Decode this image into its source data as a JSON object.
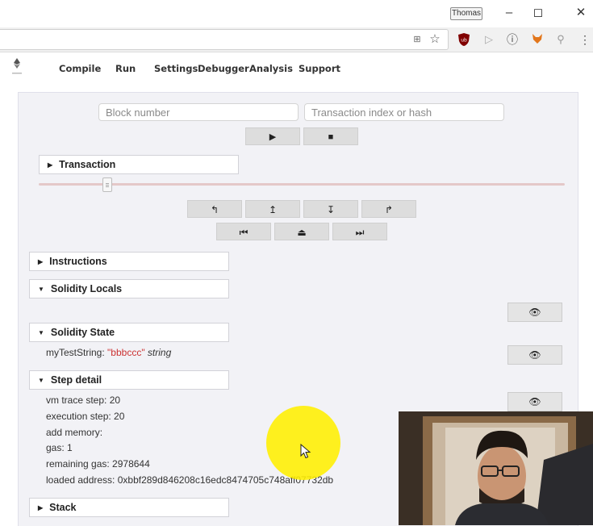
{
  "window": {
    "user": "Thomas",
    "minimize": "–",
    "maximize": "◻",
    "close": "✕"
  },
  "browser": {
    "extensions": [
      "translate-icon",
      "star-icon",
      "ublock-icon",
      "cursor-icon",
      "info-icon",
      "fox-icon",
      "search-icon",
      "menu-icon"
    ]
  },
  "remix": {
    "tabs": [
      "Compile",
      "Run",
      "Settings",
      "Debugger",
      "Analysis",
      "Support"
    ],
    "active_tab": "Debugger"
  },
  "debugger": {
    "block_placeholder": "Block number",
    "tx_placeholder": "Transaction index or hash",
    "play": "▶",
    "stop": "■",
    "transaction_label": "Transaction",
    "slider_position": 0.13,
    "step_buttons": [
      "↰",
      "↥",
      "↧",
      "↱"
    ],
    "jump_buttons": [
      "⏮",
      "⏏",
      "⏭"
    ],
    "sections": {
      "instructions": "Instructions",
      "locals": "Solidity Locals",
      "state": "Solidity State",
      "step": "Step detail",
      "stack": "Stack"
    },
    "state_var": {
      "name": "myTestString: ",
      "value": "\"bbbccc\"",
      "type": " string"
    },
    "step_detail": [
      "vm trace step: 20",
      "execution step: 20",
      "add memory:",
      "gas: 1",
      "remaining gas: 2978644",
      "loaded address: 0xbbf289d846208c16edc8474705c748aff07732db"
    ],
    "eye": "👁"
  },
  "colors": {
    "string_value": "#cc3333",
    "slider_track": "#e4c8c8",
    "highlight": "#ffef00"
  }
}
